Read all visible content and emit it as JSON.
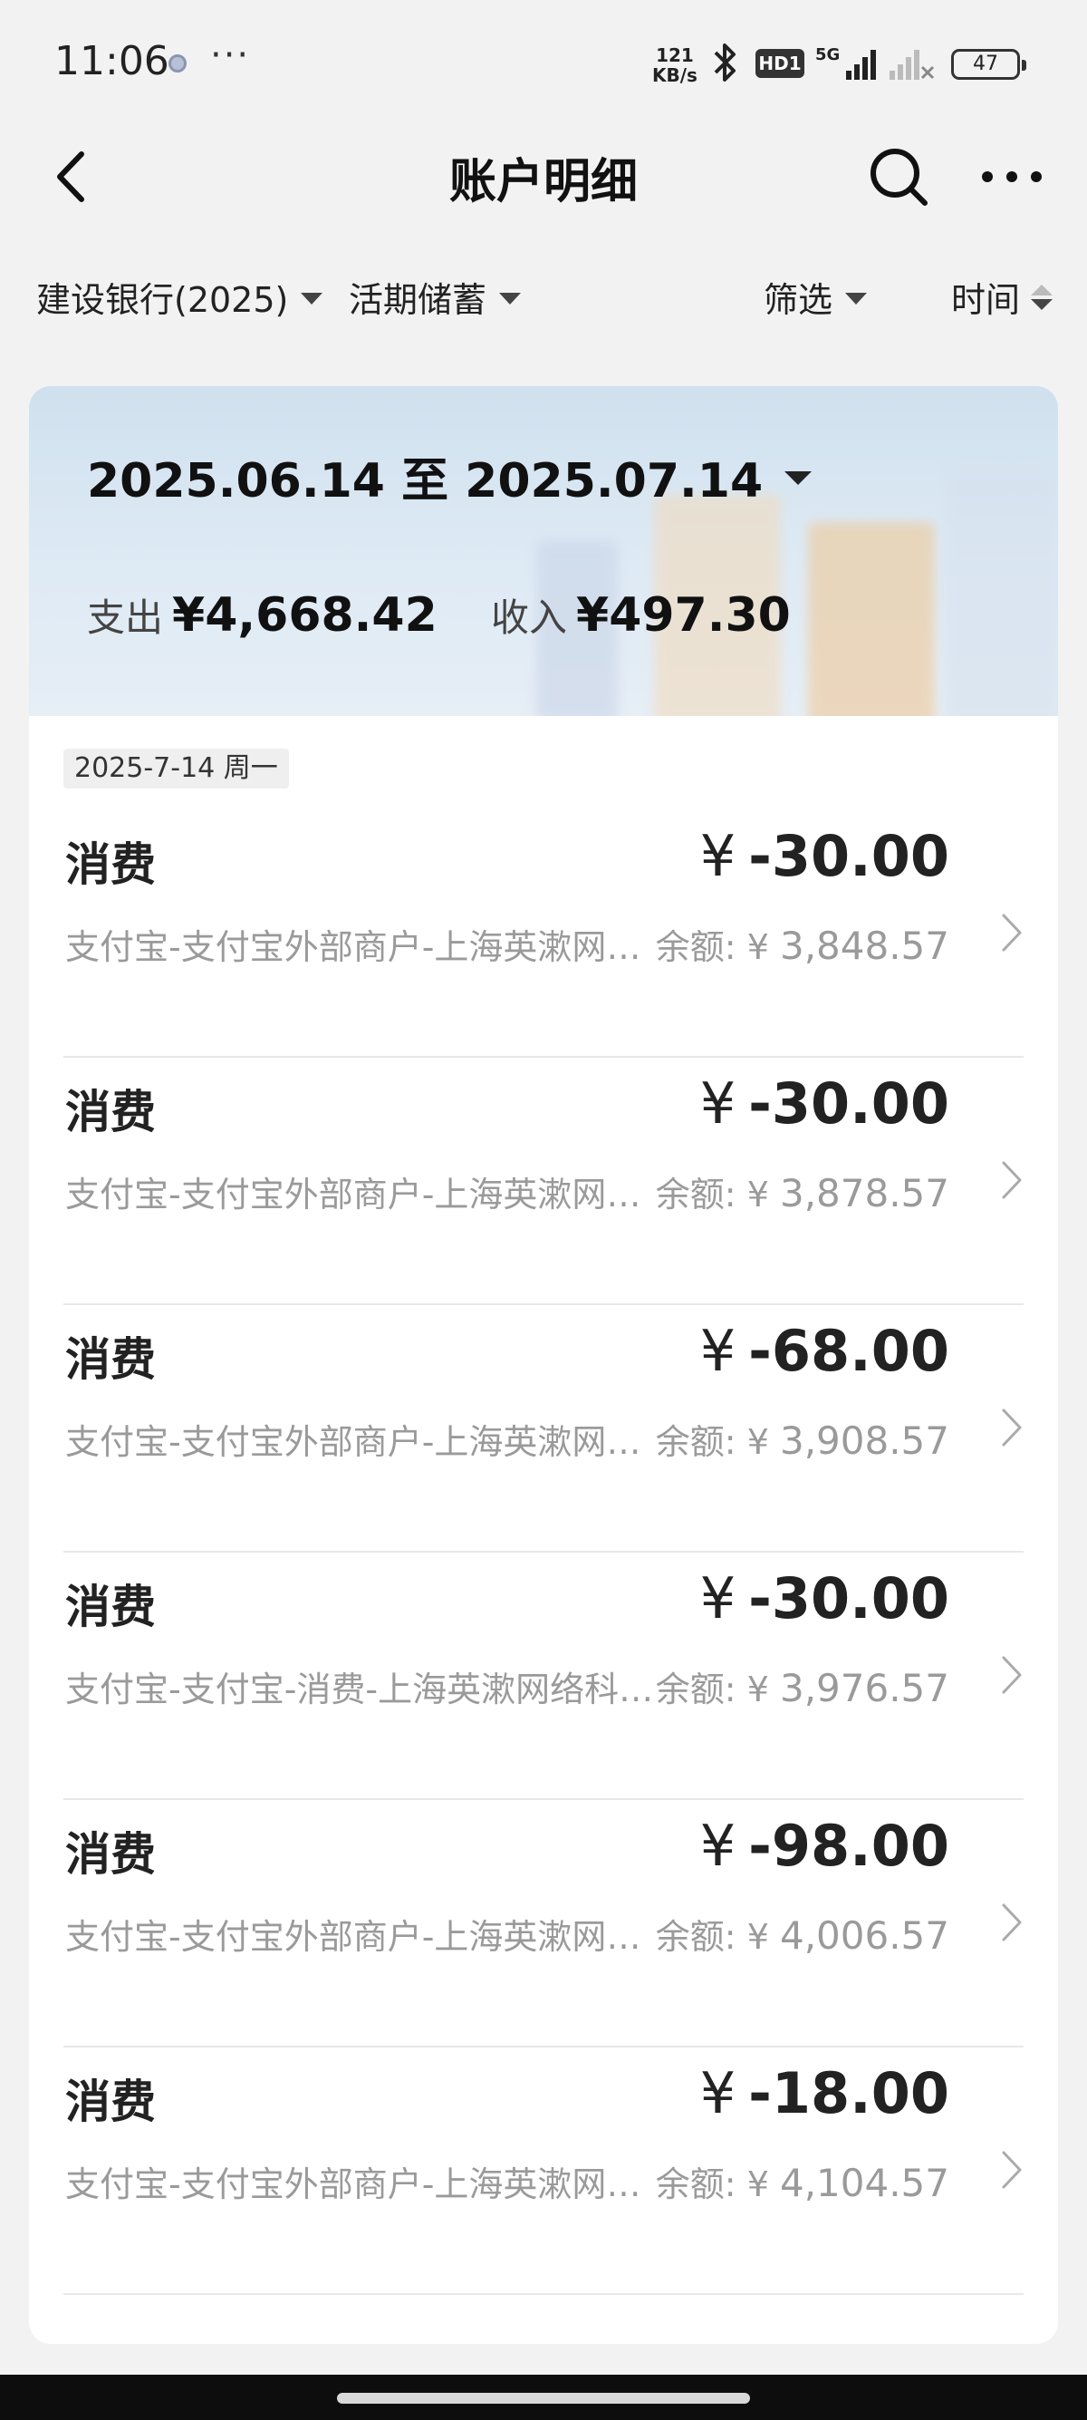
{
  "status_bar": {
    "time": "11:06",
    "more": "···",
    "net_speed_value": "121",
    "net_speed_unit": "KB/s",
    "hd_label": "HD1",
    "network_label": "5G",
    "battery": "47"
  },
  "nav": {
    "title": "账户明细",
    "icons": [
      "back-icon",
      "search-icon",
      "more-icon"
    ]
  },
  "filters": {
    "account": "建设银行(2025)",
    "account_type": "活期储蓄",
    "filter": "筛选",
    "sort": "时间"
  },
  "summary": {
    "date_range": "2025.06.14 至 2025.07.14",
    "expense_label": "支出",
    "expense_value": "¥4,668.42",
    "income_label": "收入",
    "income_value": "¥497.30"
  },
  "date_chip": "2025-7-14 周一",
  "balance_label": "余额:",
  "currency_symbol": "¥",
  "transactions": [
    {
      "type": "消费",
      "amount": "-30.00",
      "desc": "支付宝-支付宝外部商户-上海英漱网络科技有限公司",
      "balance": "3,848.57"
    },
    {
      "type": "消费",
      "amount": "-30.00",
      "desc": "支付宝-支付宝外部商户-上海英漱网络科技有限公司",
      "balance": "3,878.57"
    },
    {
      "type": "消费",
      "amount": "-68.00",
      "desc": "支付宝-支付宝外部商户-上海英漱网络科技有限公司",
      "balance": "3,908.57"
    },
    {
      "type": "消费",
      "amount": "-30.00",
      "desc": "支付宝-支付宝-消费-上海英漱网络科技有限公司",
      "balance": "3,976.57"
    },
    {
      "type": "消费",
      "amount": "-98.00",
      "desc": "支付宝-支付宝外部商户-上海英漱网络科技有限公司",
      "balance": "4,006.57"
    },
    {
      "type": "消费",
      "amount": "-18.00",
      "desc": "支付宝-支付宝外部商户-上海英漱网络科技有限公司",
      "balance": "4,104.57"
    }
  ]
}
